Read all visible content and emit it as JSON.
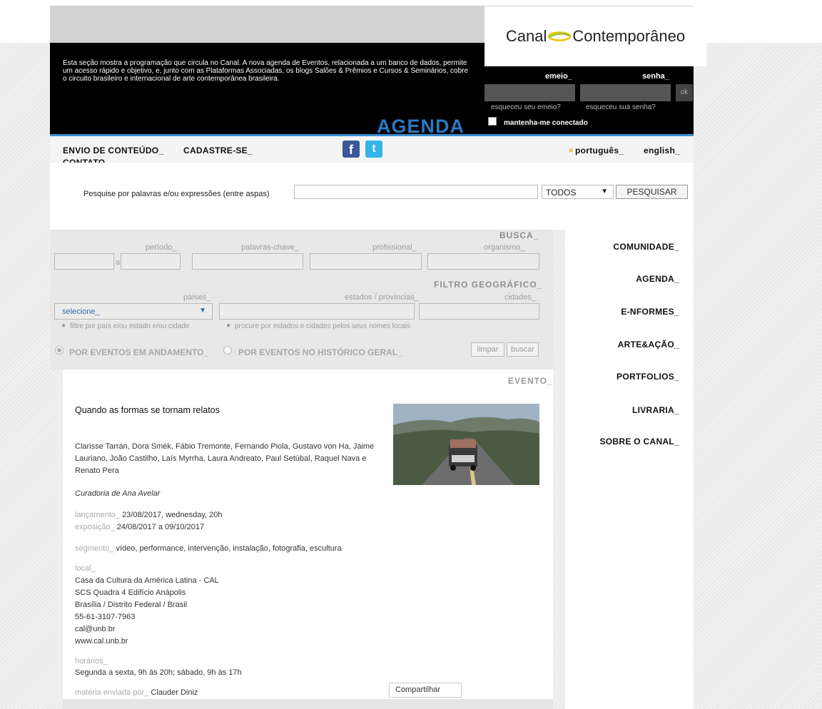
{
  "brand": {
    "left": "Canal",
    "right": "Contemporâneo"
  },
  "intro": "Esta seção mostra a programação que circula no Canal. A nova agenda de Eventos, relacionada a um banco de dados, permite um acesso rápido e objetivo, e, junto com as Plataformas Associadas, os blogs Salões & Prêmios e Cursos & Seminários, cobre o circuito brasileiro e internacional de arte contemporânea brasileira.",
  "login": {
    "email_label": "emeio_",
    "password_label": "senha_",
    "ok_label": "ok",
    "forgot_email": "esqueceu seu emeio?",
    "forgot_password": "esqueceu sua senha?",
    "remember": "mantenha-me conectado"
  },
  "section_title": "AGENDA",
  "nav": {
    "envio": "ENVIO DE CONTEÚDO_",
    "cadastre": "CADASTRE-SE_",
    "contato": "CONTATO_",
    "facebook_glyph": "f",
    "twitter_glyph": "t",
    "lang_marker": "»",
    "portugues": "português_",
    "english": "english_"
  },
  "search": {
    "label": "Pesquise por palavras e/ou expressões (entre aspas)",
    "value": "",
    "scope": "TODOS",
    "button": "PESQUISAR"
  },
  "filters": {
    "busca_title": "BUSCA_",
    "periodo": "período_",
    "a": "a",
    "palavras": "palavras-chave_",
    "profissional": "profissional_",
    "organismo": "organismo_",
    "geo_title": "FILTRO GEOGRÁFICO_",
    "paises": "países_",
    "estados": "estados / províncias_",
    "cidades": "cidades_",
    "select_value": "selecione_",
    "hint1": "filtre por país e/ou estado e/ou cidade",
    "hint2": "procure por estados e cidades pelos seus nomes locais",
    "radio1": "POR EVENTOS EM ANDAMENTO_",
    "radio2": "POR EVENTOS NO HISTÓRICO GERAL_",
    "limpar": "limpar",
    "buscar": "buscar"
  },
  "menu": [
    "COMUNIDADE_",
    "AGENDA_",
    "E-NFORMES_",
    "ARTE&AÇÃO_",
    "PORTFOLIOS_",
    "LIVRARIA_",
    "SOBRE O CANAL_"
  ],
  "event": {
    "header": "EVENTO_",
    "title": "Quando as formas se tornam relatos",
    "artists": "Clarisse Tarran, Dora Smék, Fábio Tremonte, Fernando Piola, Gustavo von Ha, Jaime Lauriano, João Castilho, Laís Myrrha, Laura Andreato, Paul Setúbal, Raquel Nava e Renato Pera",
    "curator": "Curadoria de Ana Avelar",
    "launch_label": "lançamento_",
    "launch_value": "23/08/2017, wednesday, 20h",
    "expo_label": "exposição_",
    "expo_value": "24/08/2017 a 09/10/2017",
    "segment_label": "segmento_",
    "segment_value": "vídeo, performance, intervenção, instalação, fotografia, escultura",
    "local_label": "local_",
    "local_lines": [
      "Casa da Cultura da América Latina - CAL",
      "SCS Quadra 4 Edifício Anápolis",
      "Brasília / Distrito Federal / Brasil",
      "55-61-3107-7963",
      "cal@unb.br",
      "www.cal.unb.br"
    ],
    "hours_label": "horários_",
    "hours_value": "Segunda a sexta, 9h às 20h; sábado, 9h às 17h",
    "sent_label": "matéria enviada por_",
    "sent_value": "Clauder Diniz",
    "share": "Compartilhar"
  }
}
